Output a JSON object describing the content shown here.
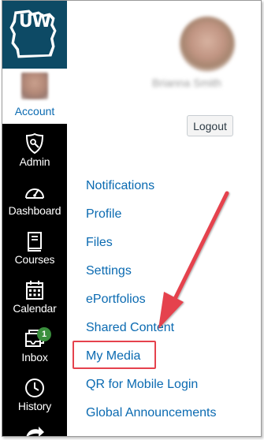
{
  "logo": {
    "text": "UW",
    "color": "#0d4a65"
  },
  "account": {
    "label": "Account"
  },
  "nav": [
    {
      "label": "Admin",
      "icon": "admin-shield-icon"
    },
    {
      "label": "Dashboard",
      "icon": "dashboard-gauge-icon"
    },
    {
      "label": "Courses",
      "icon": "courses-book-icon"
    },
    {
      "label": "Calendar",
      "icon": "calendar-icon"
    },
    {
      "label": "Inbox",
      "icon": "inbox-icon",
      "badge": "1"
    },
    {
      "label": "History",
      "icon": "history-clock-icon"
    }
  ],
  "profile": {
    "name": "Brianna Smith",
    "logout_label": "Logout"
  },
  "menu": [
    "Notifications",
    "Profile",
    "Files",
    "Settings",
    "ePortfolios",
    "Shared Content",
    "My Media",
    "QR for Mobile Login",
    "Global Announcements"
  ],
  "annotation": {
    "highlighted_item": "My Media",
    "color": "#e5424d"
  },
  "colors": {
    "nav_bg": "#000000",
    "link": "#0a6ab1",
    "badge": "#3a8f3d"
  }
}
